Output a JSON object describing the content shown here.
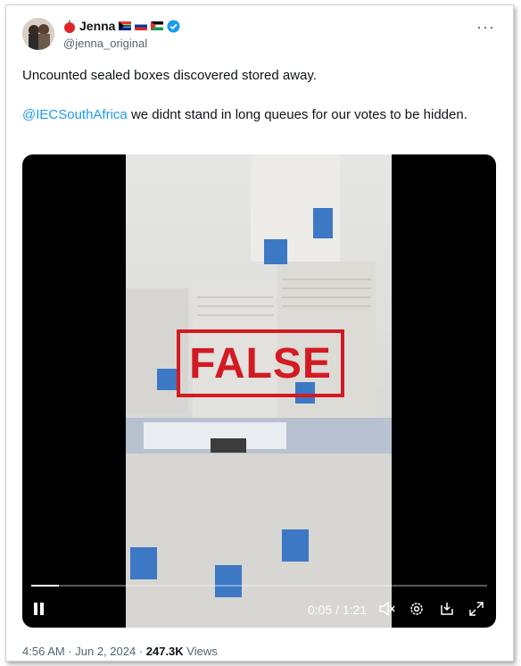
{
  "tweet": {
    "display_name": "Jenna",
    "handle": "@jenna_original",
    "text_line1": "Uncounted sealed boxes discovered stored away.",
    "mention": "@IECSouthAfrica",
    "text_line2_rest": " we didnt stand in long queues for our votes to be hidden.",
    "more_icon": "···"
  },
  "video": {
    "stamp_text": "FALSE",
    "time_display": "0:05 / 1:21",
    "progress_fraction": 0.06,
    "play_state_icon": "pause-icon"
  },
  "footer": {
    "timestamp": "4:56 AM · Jun 2, 2024 · ",
    "views_count": "247.3K",
    "views_label": " Views"
  },
  "colors": {
    "link": "#1d9bf0",
    "verified": "#1d9bf0",
    "stamp": "#d21a23"
  }
}
